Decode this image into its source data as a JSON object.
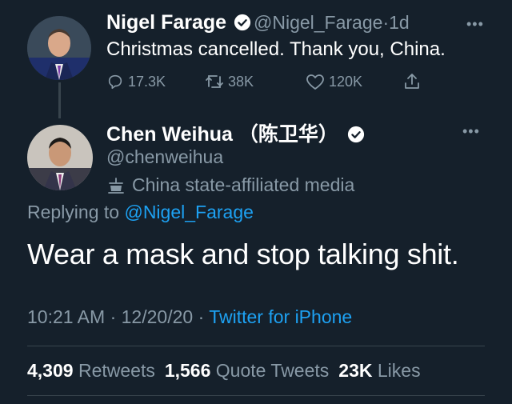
{
  "parent_tweet": {
    "display_name": "Nigel Farage",
    "handle": "@Nigel_Farage",
    "separator": "·",
    "time_ago": "1d",
    "text": "Christmas cancelled. Thank you, China.",
    "actions": {
      "replies": "17.3K",
      "retweets": "38K",
      "likes": "120K"
    }
  },
  "reply_tweet": {
    "display_name": "Chen Weihua （陈卫华）",
    "handle": "@chenweihua",
    "label": "China state-affiliated media",
    "replying_prefix": "Replying to",
    "replying_handle": "@Nigel_Farage",
    "text": "Wear a mask and stop talking shit.",
    "time": "10:21 AM",
    "separator": "·",
    "date": "12/20/20",
    "separator2": "·",
    "client": "Twitter for iPhone",
    "stats": {
      "retweets_count": "4,309",
      "retweets_label": "Retweets",
      "quotes_count": "1,566",
      "quotes_label": "Quote Tweets",
      "likes_count": "23K",
      "likes_label": "Likes"
    }
  },
  "colors": {
    "background": "#15202b",
    "text": "#ffffff",
    "muted": "#8899a6",
    "link": "#1da1f2",
    "divider": "#38444d"
  },
  "icons": [
    "verified-badge-icon",
    "more-icon",
    "reply-icon",
    "retweet-icon",
    "like-icon",
    "share-icon",
    "state-media-icon"
  ]
}
